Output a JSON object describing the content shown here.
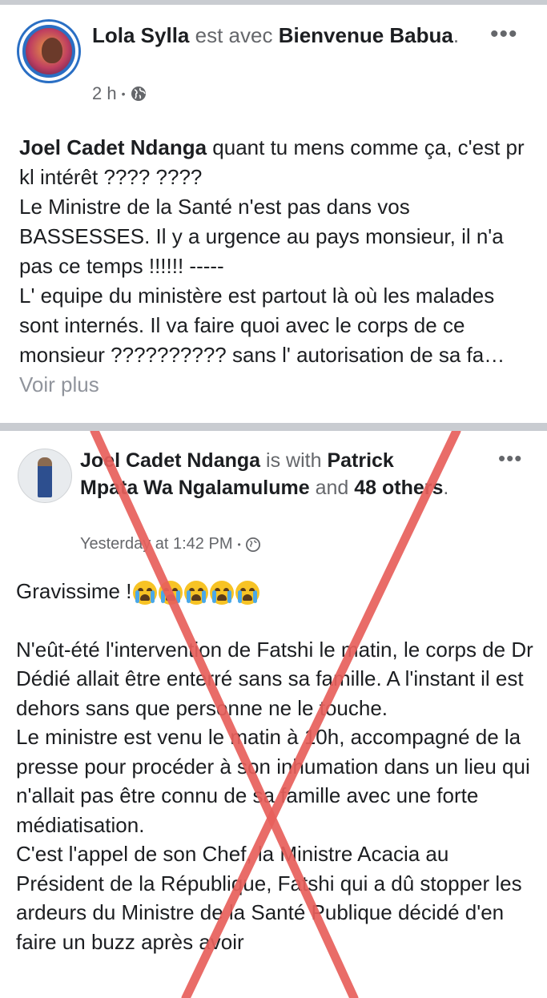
{
  "post1": {
    "author": "Lola Sylla",
    "with_text": "est avec",
    "tagged": "Bienvenue Babua",
    "period": ".",
    "time": "2 h",
    "dot": "•",
    "privacy_icon": "globe-icon",
    "more_label": "•••",
    "body_author": "Joel Cadet Ndanga",
    "body_lines": [
      " quant tu mens comme ça, c'est pr kl intérêt ???? ????",
      "Le Ministre de la Santé n'est pas dans vos BASSESSES. Il y a urgence au pays monsieur, il n'a pas ce temps  !!!!!! -----",
      "L' equipe du ministère est partout là où les malades sont internés. Il va faire quoi avec le corps de ce monsieur ??????????  sans l' autorisation de sa fa… "
    ],
    "see_more": "Voir plus"
  },
  "post2": {
    "author": "Joel Cadet Ndanga",
    "with_text": "is with",
    "tagged": "Patrick Mpata Wa Ngalamulume",
    "and_text": "and",
    "others": "48 others",
    "period": ".",
    "time": "Yesterday at 1:42 PM",
    "dot": "•",
    "privacy_icon": "globe-icon",
    "more_label": "•••",
    "headline": "Gravissime !",
    "emoji": [
      "crying-face-icon",
      "crying-face-icon",
      "crying-face-icon",
      "crying-face-icon",
      "crying-face-icon"
    ],
    "paragraphs": [
      "N'eût-été l'intervention de Fatshi le matin, le corps de Dr Dédié allait être enterré sans sa famille. A l'instant il est dehors sans que personne ne le touche.",
      "Le ministre est venu le matin à 10h, accompagné de la presse pour procéder à son inhumation dans un lieu qui n'allait pas être connu de sa famille avec une forte médiatisation.",
      "C'est l'appel de son Chef, la Ministre Acacia au Président de la République, Fatshi qui a dû stopper les ardeurs du Ministre de la Santé Publique décidé d'en faire un buzz après avoir"
    ]
  },
  "colors": {
    "x_mark": "#e8605c",
    "divider": "#c9ccd1",
    "muted": "#65676b",
    "avatar_ring": "#2a6fc4"
  }
}
